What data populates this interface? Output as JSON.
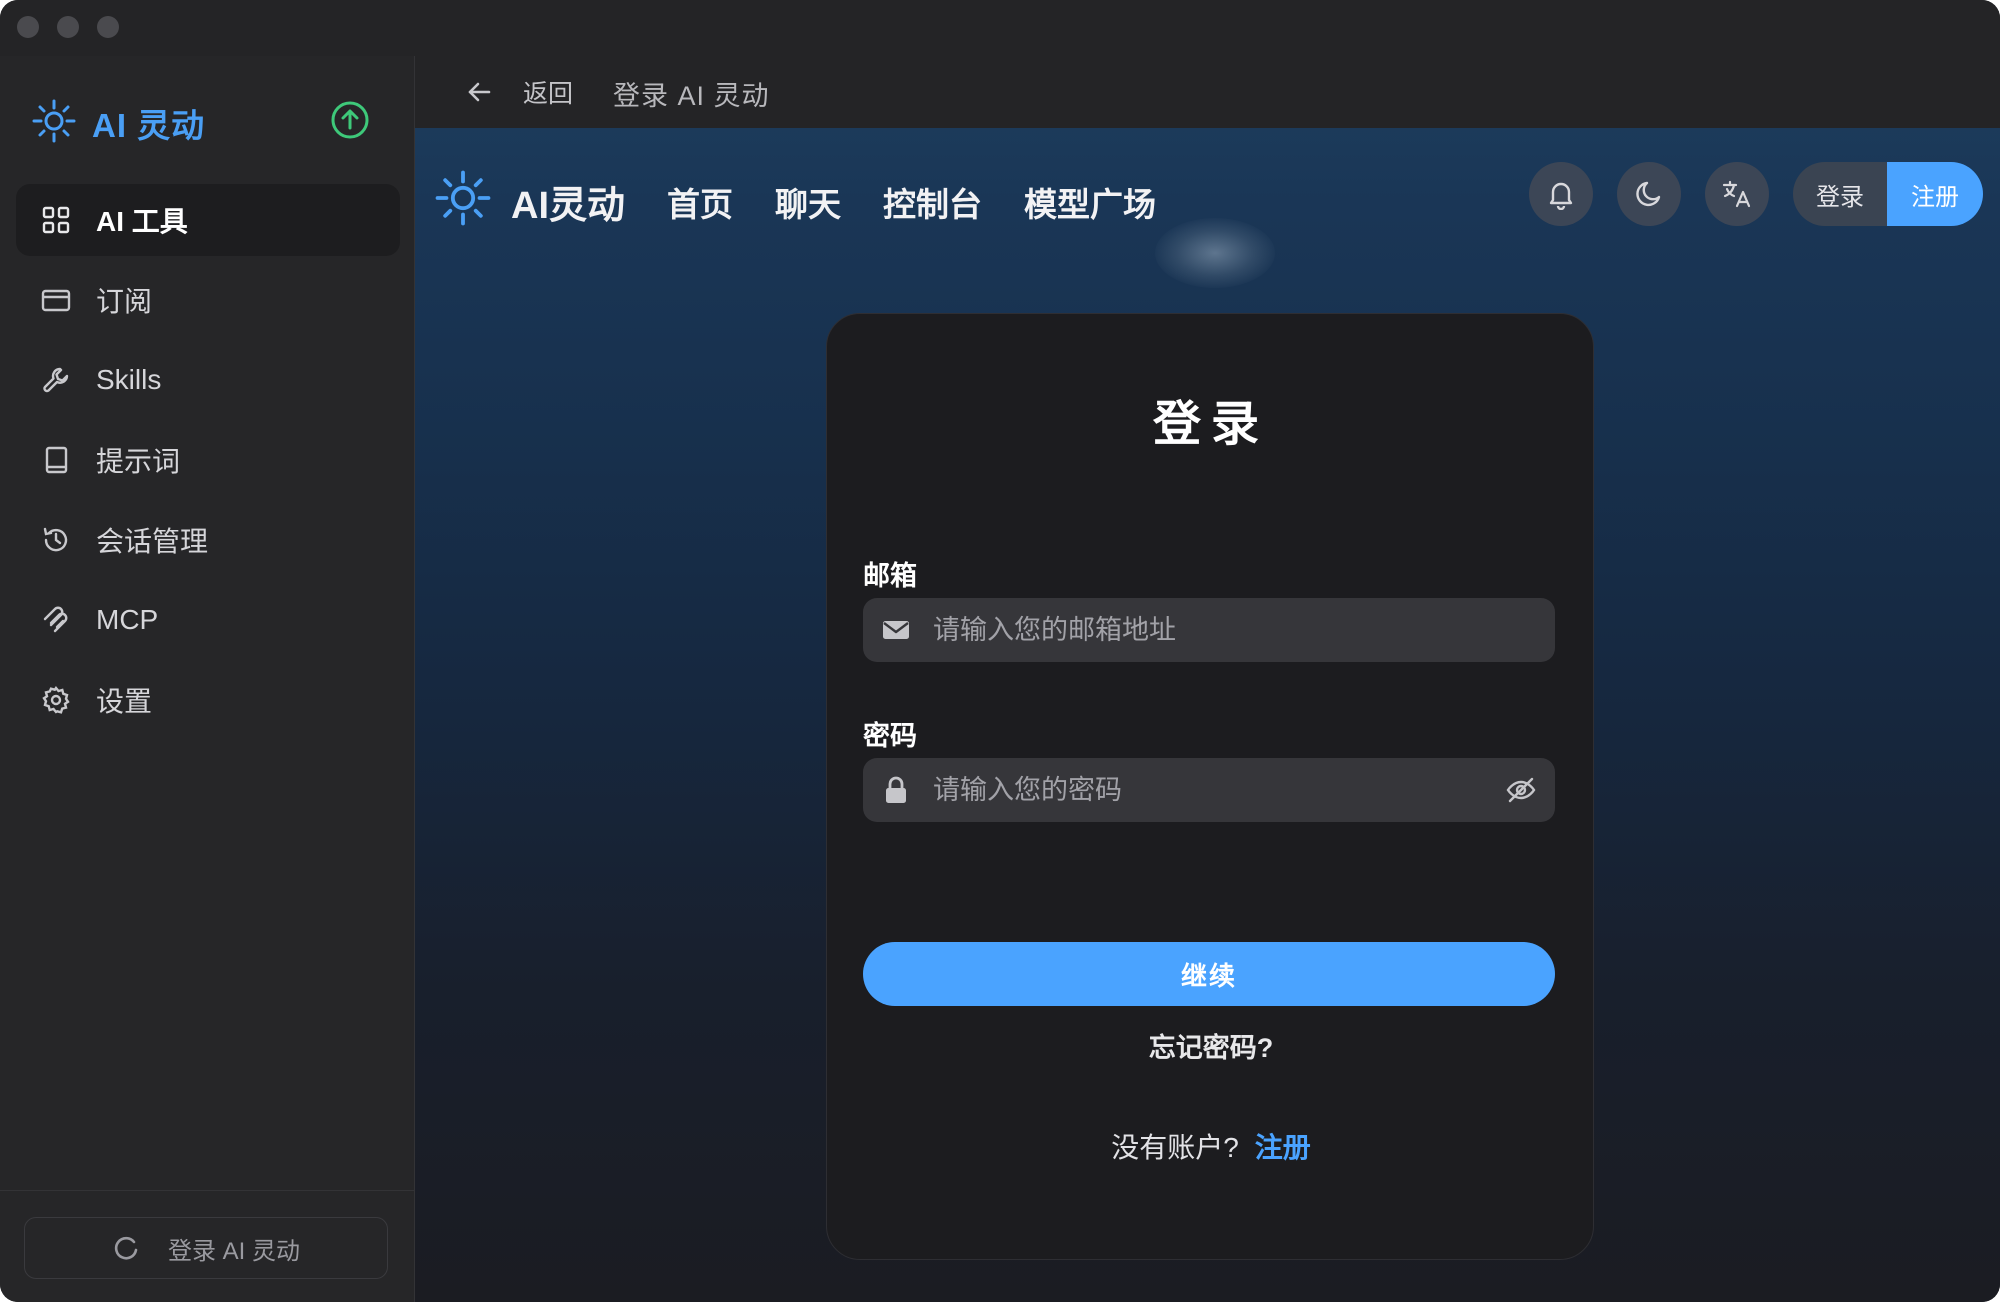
{
  "sidebar": {
    "brand": "AI 灵动",
    "items": [
      {
        "label": "AI 工具",
        "icon": "grid-icon"
      },
      {
        "label": "订阅",
        "icon": "credit-card-icon"
      },
      {
        "label": "Skills",
        "icon": "wrench-icon"
      },
      {
        "label": "提示词",
        "icon": "book-icon"
      },
      {
        "label": "会话管理",
        "icon": "history-icon"
      },
      {
        "label": "MCP",
        "icon": "mcp-icon"
      },
      {
        "label": "设置",
        "icon": "gear-icon"
      }
    ],
    "footer_login": "登录 AI 灵动"
  },
  "topbar": {
    "back_label": "返回",
    "page_title": "登录 AI 灵动"
  },
  "site": {
    "name": "AI灵动",
    "nav": [
      "首页",
      "聊天",
      "控制台",
      "模型广场"
    ],
    "login_label": "登录",
    "register_label": "注册"
  },
  "login": {
    "title": "登录",
    "email_label": "邮箱",
    "email_placeholder": "请输入您的邮箱地址",
    "password_label": "密码",
    "password_placeholder": "请输入您的密码",
    "continue_label": "继续",
    "forgot_label": "忘记密码?",
    "no_account_label": "没有账户?",
    "register_link": "注册"
  },
  "colors": {
    "accent": "#4aa3ff",
    "brand": "#4a9ff5",
    "upgrade": "#3ec97a"
  }
}
